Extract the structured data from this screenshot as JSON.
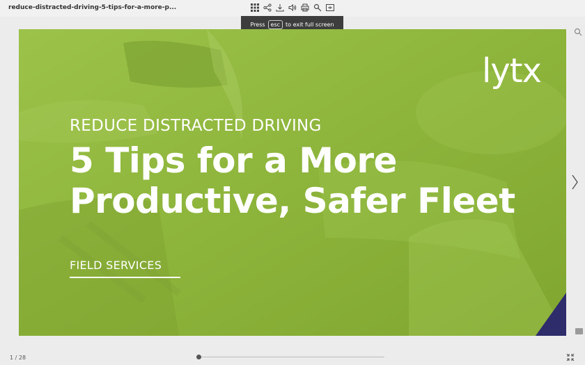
{
  "document": {
    "title": "reduce-distracted-driving-5-tips-for-a-more-p..."
  },
  "toolbar": {
    "buttons": [
      "grid-icon",
      "share-icon",
      "download-icon",
      "sound-icon",
      "print-icon",
      "zoom-icon",
      "fit-icon"
    ]
  },
  "toast": {
    "prefix": "Press",
    "key": "esc",
    "suffix": "to exit full screen"
  },
  "slide": {
    "brand": "lytx",
    "kicker": "REDUCE DISTRACTED DRIVING",
    "headline_line1": "5 Tips for a More",
    "headline_line2": "Productive, Safer Fleet",
    "section": "FIELD SERVICES",
    "colors": {
      "background": "#8fb53d",
      "corner": "#2f2c6b",
      "text": "#ffffff"
    }
  },
  "pager": {
    "label": "1 / 28",
    "current": 1,
    "total": 28
  }
}
